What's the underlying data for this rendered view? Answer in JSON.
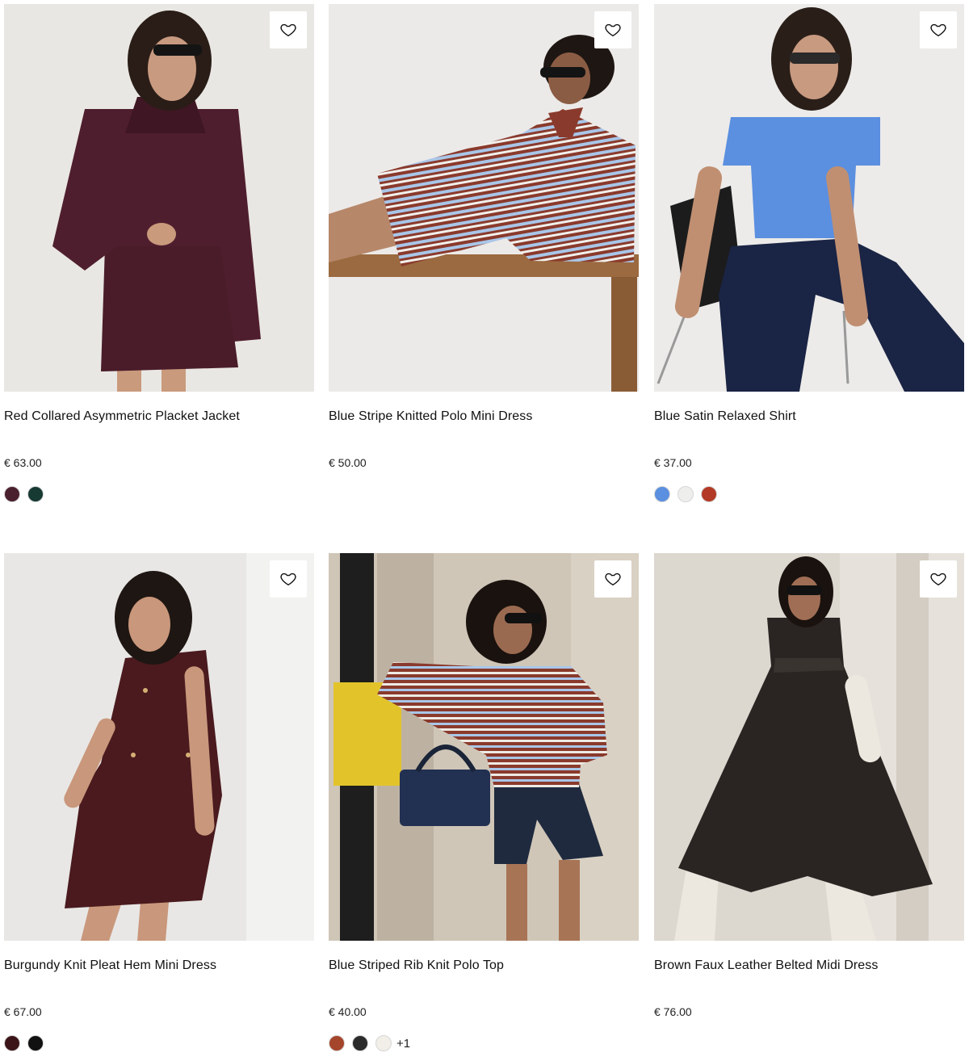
{
  "products": [
    {
      "name": "Red Collared Asymmetric Placket Jacket",
      "price": "€ 63.00",
      "swatches": [
        "#4a1f2e",
        "#173a33"
      ],
      "more": ""
    },
    {
      "name": "Blue Stripe Knitted Polo Mini Dress",
      "price": "€ 50.00",
      "swatches": [],
      "more": ""
    },
    {
      "name": "Blue Satin Relaxed Shirt",
      "price": "€ 37.00",
      "swatches": [
        "#5b8fe0",
        "#eeeeec",
        "#b23a26"
      ],
      "more": ""
    },
    {
      "name": "Burgundy Knit Pleat Hem Mini Dress",
      "price": "€ 67.00",
      "swatches": [
        "#3a1418",
        "#111111"
      ],
      "more": ""
    },
    {
      "name": "Blue Striped Rib Knit Polo Top",
      "price": "€ 40.00",
      "swatches": [
        "#a5452b",
        "#2b2b2b",
        "#f1efe8"
      ],
      "more": "+1"
    },
    {
      "name": "Brown Faux Leather Belted Midi Dress",
      "price": "€ 76.00",
      "swatches": [],
      "more": ""
    }
  ],
  "icons": {
    "wishlist": "heart-outline-icon"
  }
}
